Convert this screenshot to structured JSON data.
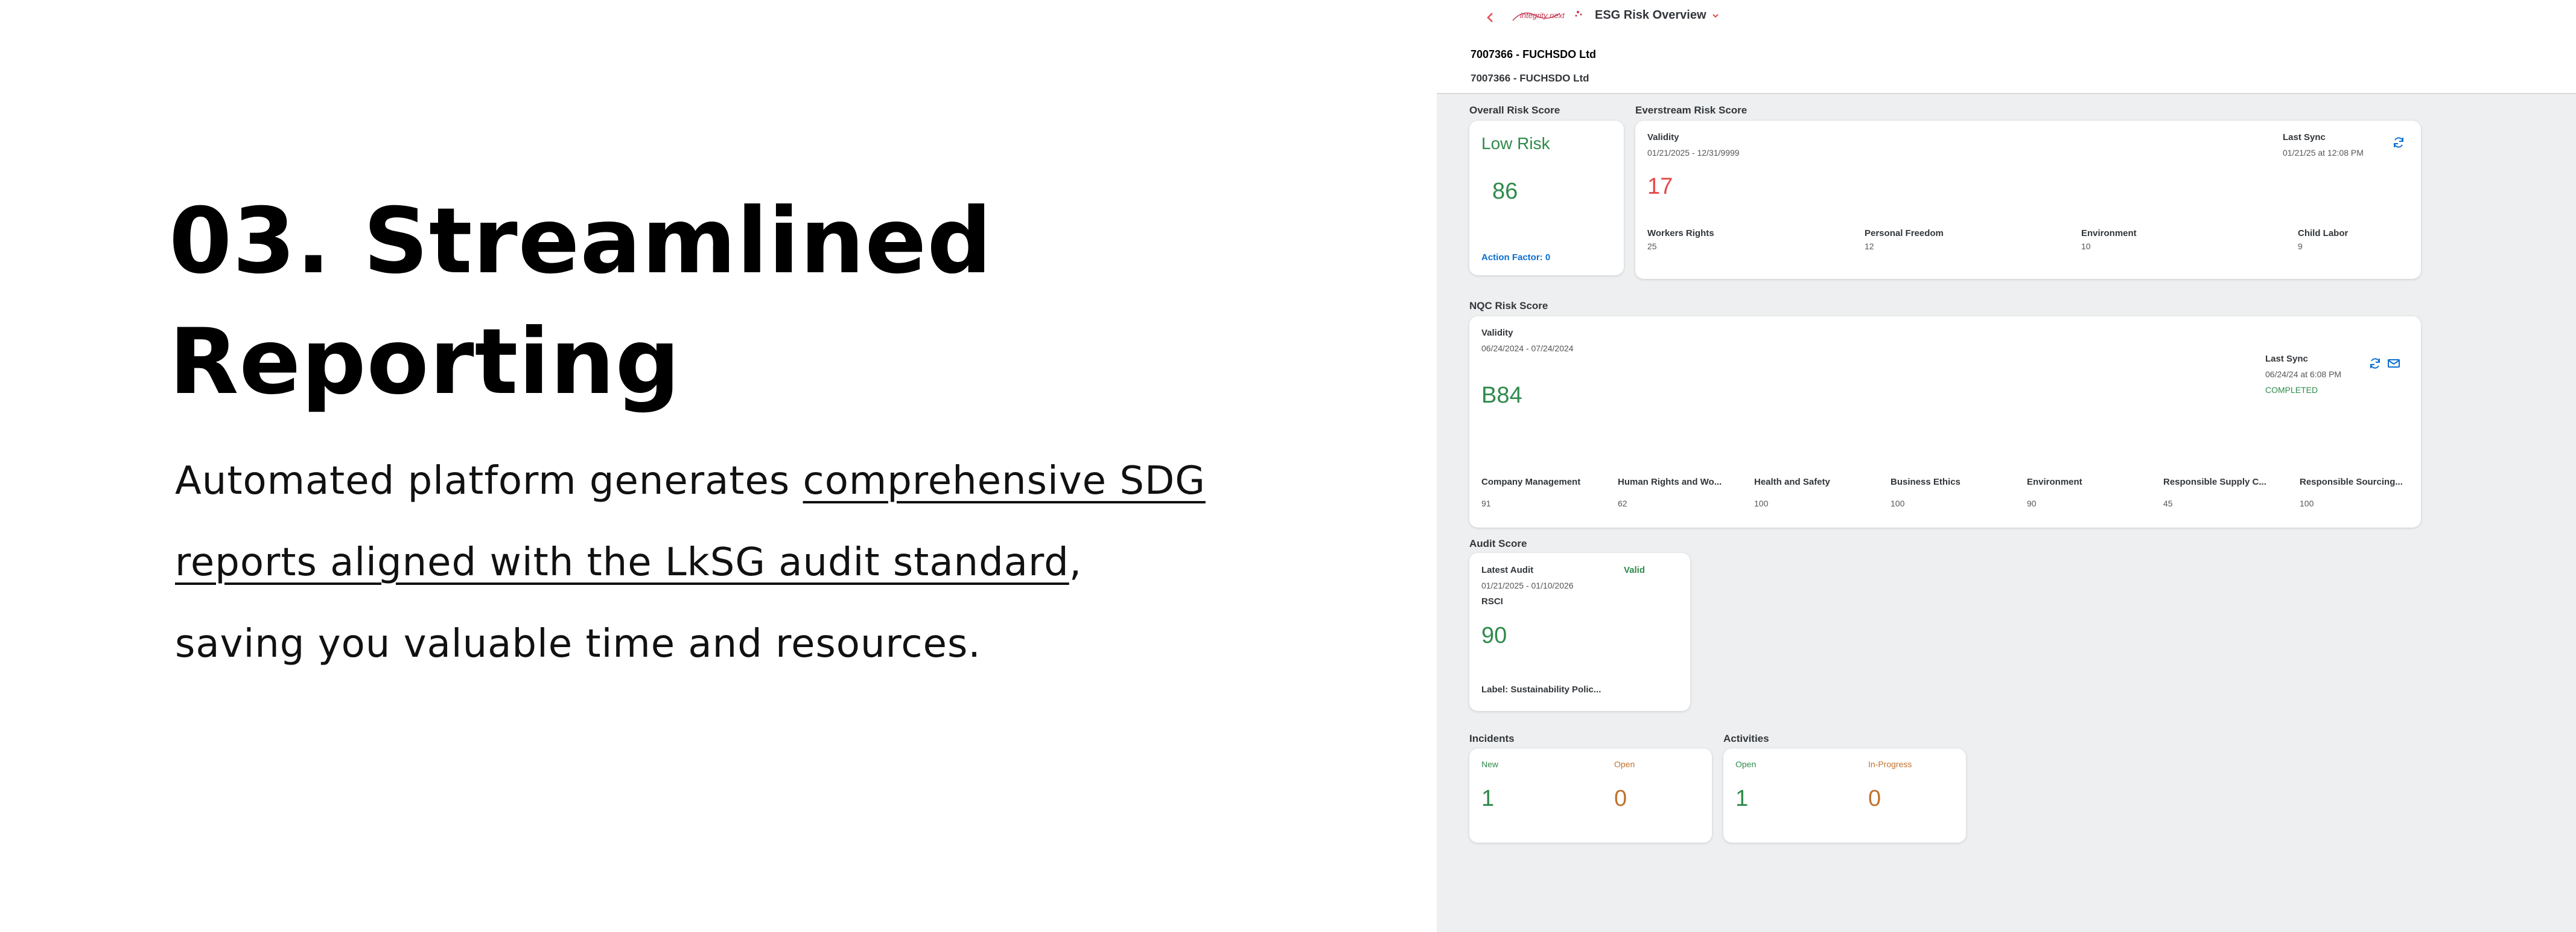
{
  "slide": {
    "title": "03. Streamlined Reporting",
    "text_before": "Automated platform generates ",
    "text_link": "comprehensive SDG reports aligned with the LkSG audit standard",
    "text_after": ", saving you valuable time and resources."
  },
  "app": {
    "header": {
      "logo_text": "integrity next",
      "title": "ESG Risk Overview",
      "object_title": "7007366 - FUCHSDO Ltd",
      "object_subtitle": "7007366 - FUCHSDO Ltd"
    },
    "overall": {
      "section": "Overall Risk Score",
      "risk_label": "Low Risk",
      "score": "86",
      "action_factor": "Action Factor: 0"
    },
    "everstream": {
      "section": "Everstream Risk Score",
      "validity_label": "Validity",
      "validity_value": "01/21/2025 - 12/31/9999",
      "score": "17",
      "last_sync_label": "Last Sync",
      "last_sync_value": "01/21/25 at 12:08 PM",
      "metrics": [
        {
          "label": "Workers Rights",
          "value": "25"
        },
        {
          "label": "Personal Freedom",
          "value": "12"
        },
        {
          "label": "Environment",
          "value": "10"
        },
        {
          "label": "Child Labor",
          "value": "9"
        }
      ]
    },
    "nqc": {
      "section": "NQC Risk Score",
      "validity_label": "Validity",
      "validity_value": "06/24/2024 - 07/24/2024",
      "score": "B84",
      "last_sync_label": "Last Sync",
      "last_sync_value": "06/24/24 at 6:08 PM",
      "status": "COMPLETED",
      "metrics": [
        {
          "label": "Company Management",
          "value": "91"
        },
        {
          "label": "Human Rights and Wo...",
          "value": "62"
        },
        {
          "label": "Health and Safety",
          "value": "100"
        },
        {
          "label": "Business Ethics",
          "value": "100"
        },
        {
          "label": "Environment",
          "value": "90"
        },
        {
          "label": "Responsible Supply C...",
          "value": "45"
        },
        {
          "label": "Responsible Sourcing...",
          "value": "100"
        }
      ]
    },
    "audit": {
      "section": "Audit Score",
      "latest_label": "Latest Audit",
      "validity_status": "Valid",
      "date_range": "01/21/2025 - 01/10/2026",
      "type": "RSCI",
      "score": "90",
      "label_text": "Label: Sustainability Polic..."
    },
    "incidents": {
      "section": "Incidents",
      "new_label": "New",
      "new_value": "1",
      "open_label": "Open",
      "open_value": "0"
    },
    "activities": {
      "section": "Activities",
      "open_label": "Open",
      "open_value": "1",
      "progress_label": "In-Progress",
      "progress_value": "0"
    }
  }
}
